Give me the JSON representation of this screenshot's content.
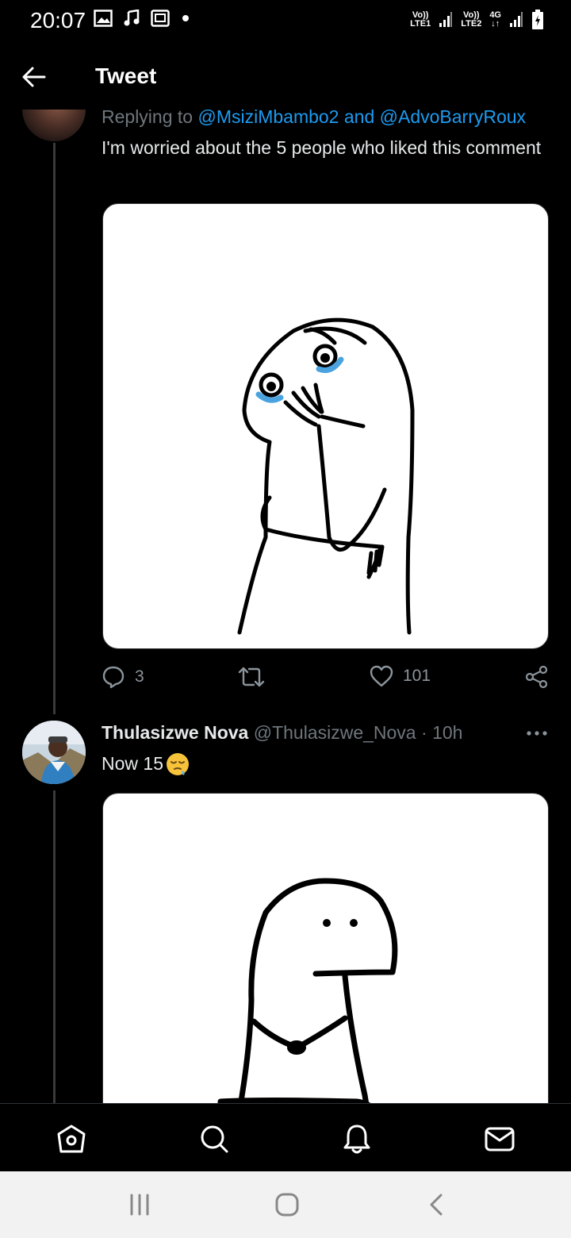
{
  "status_bar": {
    "time": "20:07",
    "left_icons": [
      "gallery-icon",
      "music-icon",
      "cast-icon",
      "notification-dot"
    ],
    "sim1_label_top": "Vo))",
    "sim1_label_bottom": "LTE1",
    "sim2_label_top": "Vo))",
    "sim2_label_bottom": "LTE2",
    "network_type": "4G",
    "battery_icon": "charging-battery-icon"
  },
  "header": {
    "title": "Tweet",
    "back_icon": "back-arrow-icon"
  },
  "tweet1": {
    "reply_prefix": "Replying to",
    "mention1": "@MsiziMbambo2",
    "reply_and": "and",
    "mention2": "@AdvoBarryRoux",
    "text": "I'm worried about the 5 people who liked this comment",
    "media_description_icon": "crying-meme-drawing",
    "reply_count": "3",
    "retweet_count": "",
    "like_count": "101",
    "icons": [
      "reply-icon",
      "retweet-icon",
      "like-icon",
      "share-icon"
    ]
  },
  "tweet2": {
    "name": "Thulasizwe Nova",
    "handle": "@Thulasizwe_Nova",
    "separator": "·",
    "time": "10h",
    "text": "Now 15",
    "emoji": "😪"
  },
  "bottom_nav": {
    "items": [
      "home-icon",
      "search-icon",
      "notifications-icon",
      "messages-icon"
    ]
  },
  "system_nav": {
    "items": [
      "recent-apps-icon",
      "home-button-icon",
      "back-icon"
    ]
  },
  "colors": {
    "background": "#000000",
    "accent": "#1d9bf0",
    "secondary_text": "#6e767d"
  }
}
